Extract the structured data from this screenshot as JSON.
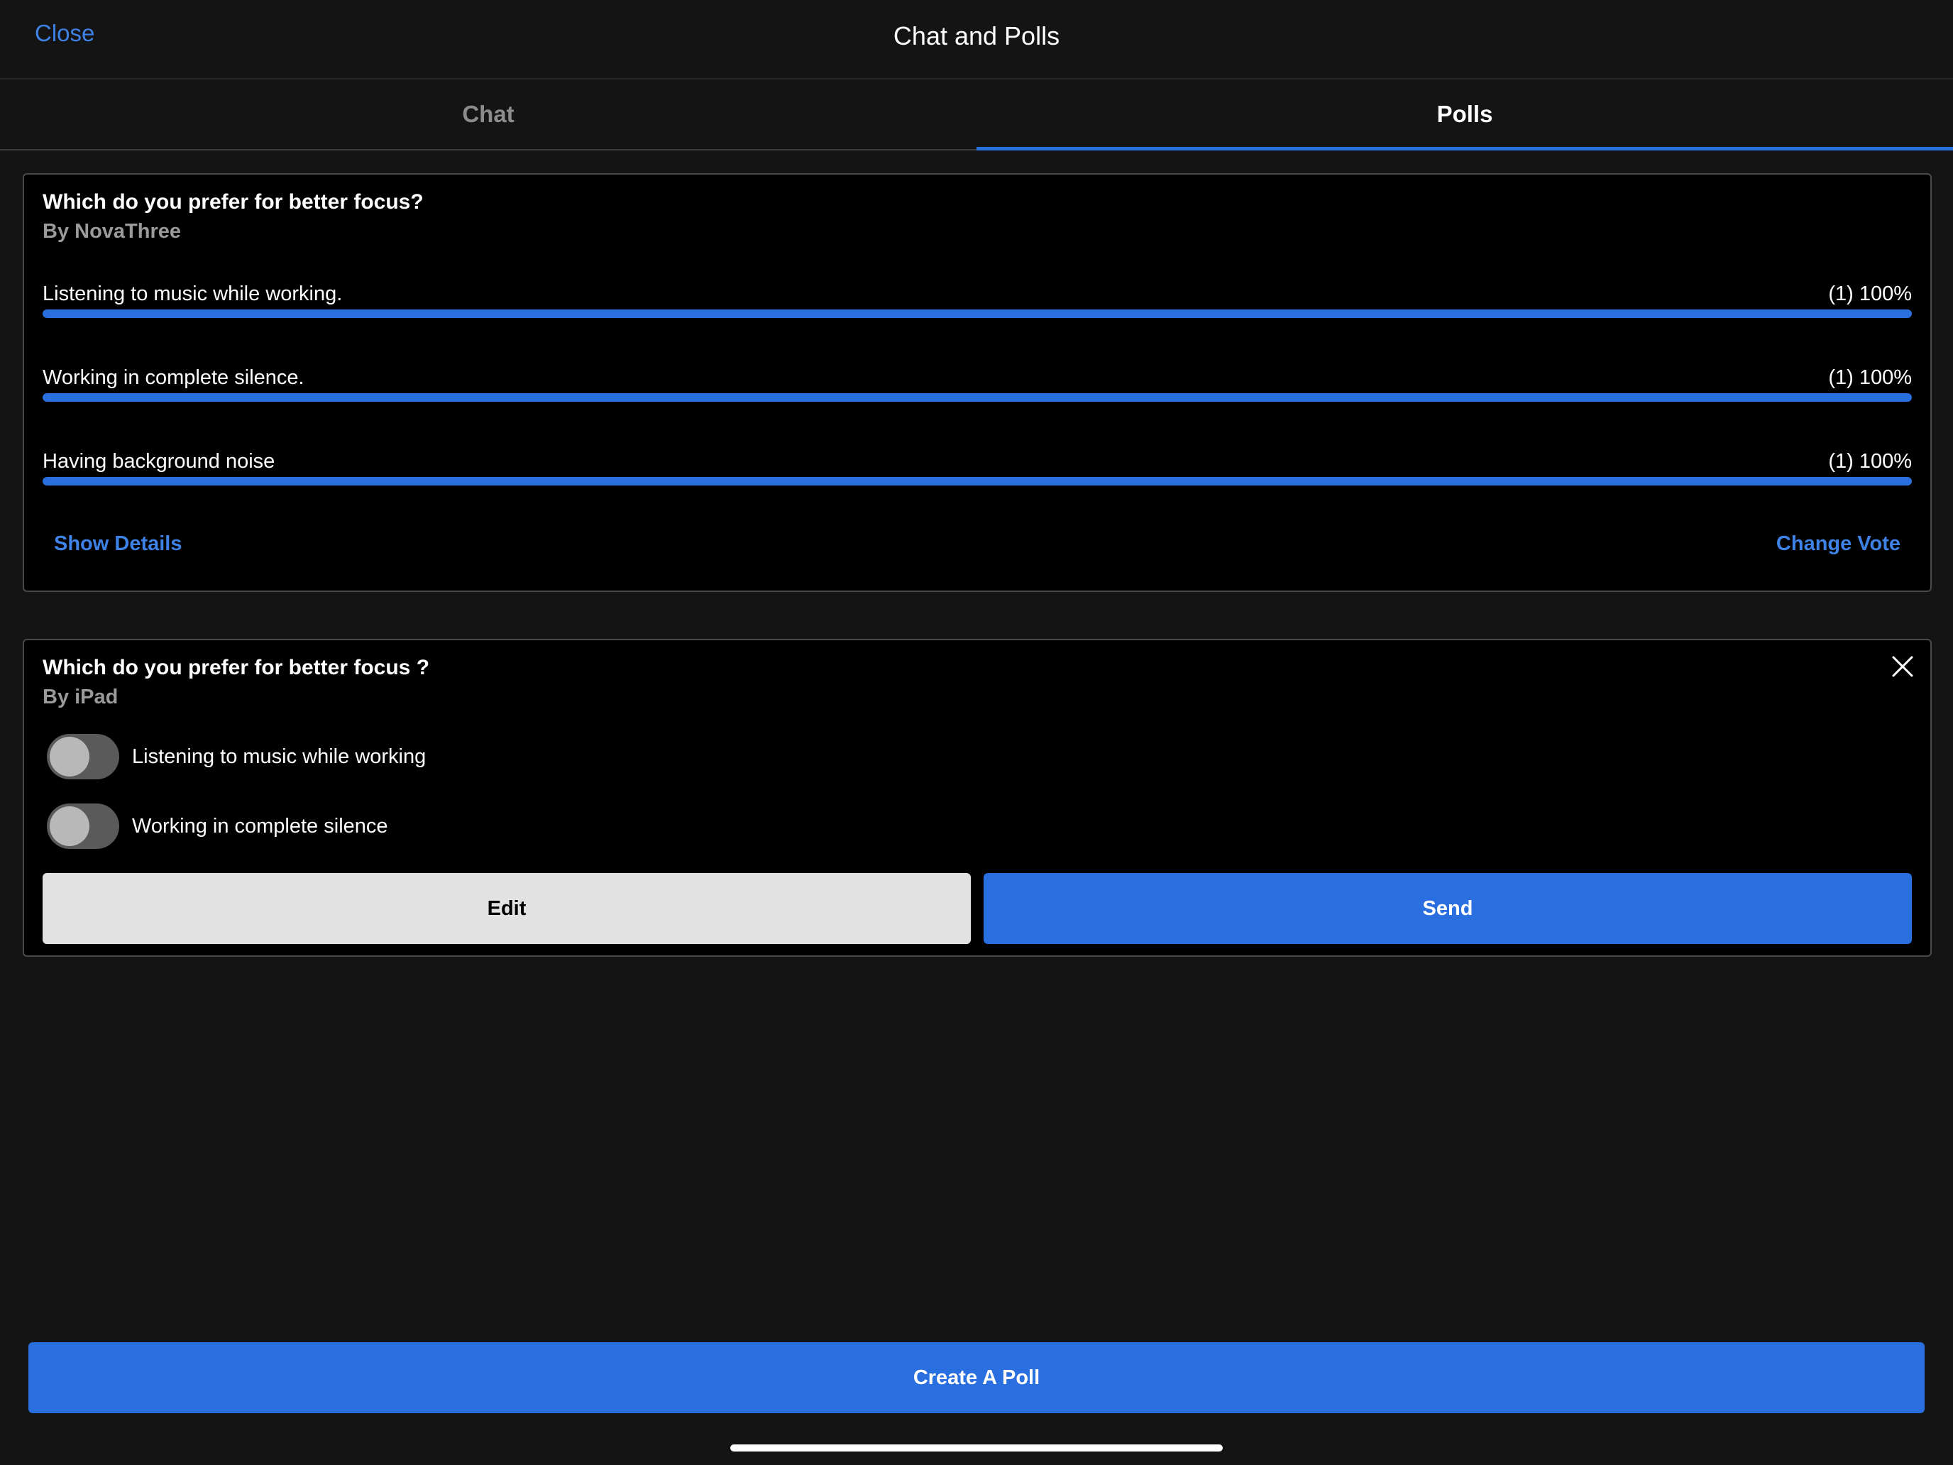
{
  "header": {
    "close_label": "Close",
    "title": "Chat and Polls"
  },
  "tabs": [
    {
      "label": "Chat",
      "active": false
    },
    {
      "label": "Polls",
      "active": true
    }
  ],
  "colors": {
    "accent": "#2a6fe0",
    "link": "#3f82e6",
    "background": "#141414",
    "card": "#000000"
  },
  "poll_results": {
    "question": "Which do you prefer for better focus?",
    "author": "By NovaThree",
    "options": [
      {
        "label": "Listening to music while working.",
        "count": "(1) 100%",
        "fraction": 1.0
      },
      {
        "label": "Working in complete silence.",
        "count": "(1) 100%",
        "fraction": 1.0
      },
      {
        "label": "Having background noise",
        "count": "(1) 100%",
        "fraction": 1.0
      }
    ],
    "show_details_label": "Show Details",
    "change_vote_label": "Change Vote"
  },
  "poll_draft": {
    "question": "Which do you prefer for better focus ?",
    "author": "By iPad",
    "close_icon": "close-icon",
    "options": [
      {
        "label": "Listening to music while working",
        "checked": false
      },
      {
        "label": "Working in complete silence",
        "checked": false
      }
    ],
    "edit_label": "Edit",
    "send_label": "Send"
  },
  "footer": {
    "create_poll_label": "Create A Poll"
  }
}
